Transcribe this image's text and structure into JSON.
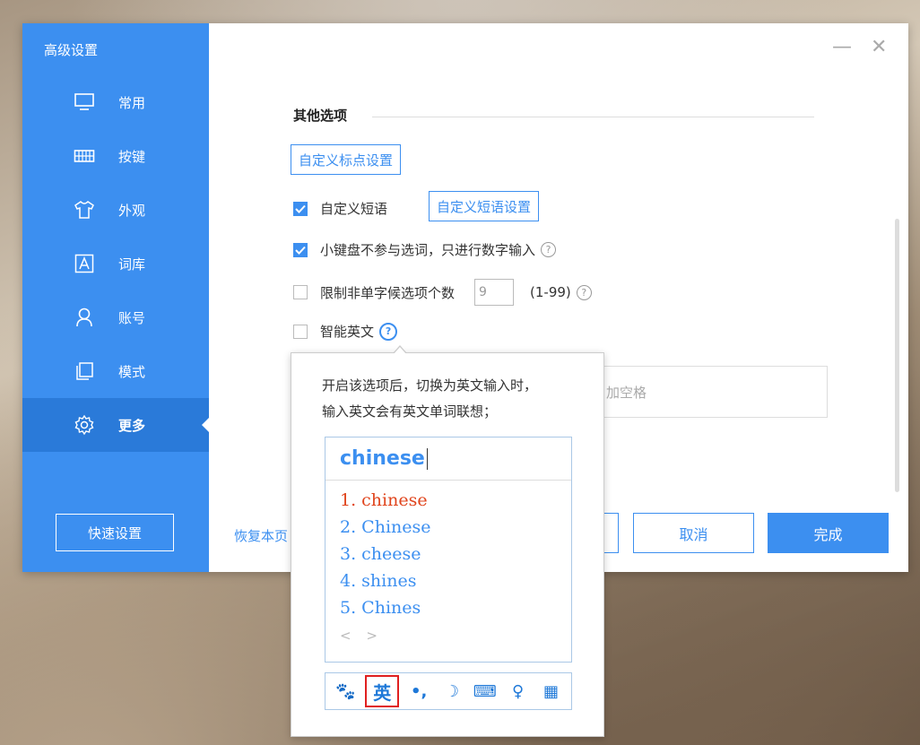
{
  "sidebar": {
    "title": "高级设置",
    "items": [
      {
        "label": "常用",
        "icon": "monitor-icon"
      },
      {
        "label": "按键",
        "icon": "keyboard-icon"
      },
      {
        "label": "外观",
        "icon": "tshirt-icon"
      },
      {
        "label": "词库",
        "icon": "letter-a-icon"
      },
      {
        "label": "账号",
        "icon": "user-icon"
      },
      {
        "label": "模式",
        "icon": "copy-icon"
      },
      {
        "label": "更多",
        "icon": "gear-icon",
        "active": true
      }
    ],
    "quick_settings": "快速设置"
  },
  "window": {
    "minimize": "—",
    "close": "✕"
  },
  "section": {
    "title": "其他选项",
    "custom_punct_btn": "自定义标点设置",
    "options": {
      "custom_phrase": {
        "label": "自定义短语",
        "checked": true,
        "button": "自定义短语设置"
      },
      "numpad": {
        "label": "小键盘不参与选词，只进行数字输入",
        "checked": true
      },
      "limit": {
        "label": "限制非单字候选项个数",
        "checked": false,
        "value": "9",
        "range": "(1-99)"
      },
      "smart_english": {
        "label": "智能英文",
        "checked": false
      }
    },
    "partial_input_text": "加空格",
    "help_glyph": "?"
  },
  "footer": {
    "restore": "恢复本页",
    "cancel": "取消",
    "done": "完成"
  },
  "tooltip": {
    "line1": "开启该选项后，切换为英文输入时，",
    "line2": "输入英文会有英文单词联想；",
    "ime": {
      "composition": "chinese",
      "candidates": [
        "1. chinese",
        "2. Chinese",
        "3. cheese",
        "4. shines",
        "5. Chines"
      ],
      "pager": "< >",
      "toolbar": [
        {
          "icon": "paw-icon",
          "glyph": "🐾"
        },
        {
          "icon": "english-mode-icon",
          "glyph": "英",
          "highlighted": true
        },
        {
          "icon": "punctuation-icon",
          "glyph": "•,"
        },
        {
          "icon": "moon-icon",
          "glyph": "☽"
        },
        {
          "icon": "keyboard-icon",
          "glyph": "⌨"
        },
        {
          "icon": "user-icon",
          "glyph": "♀"
        },
        {
          "icon": "grid-icon",
          "glyph": "▦"
        }
      ]
    }
  },
  "colors": {
    "accent": "#3c8ff0",
    "sidebar_active": "#2a7ad9",
    "highlight": "#e02020",
    "selected_candidate": "#e0441c"
  }
}
